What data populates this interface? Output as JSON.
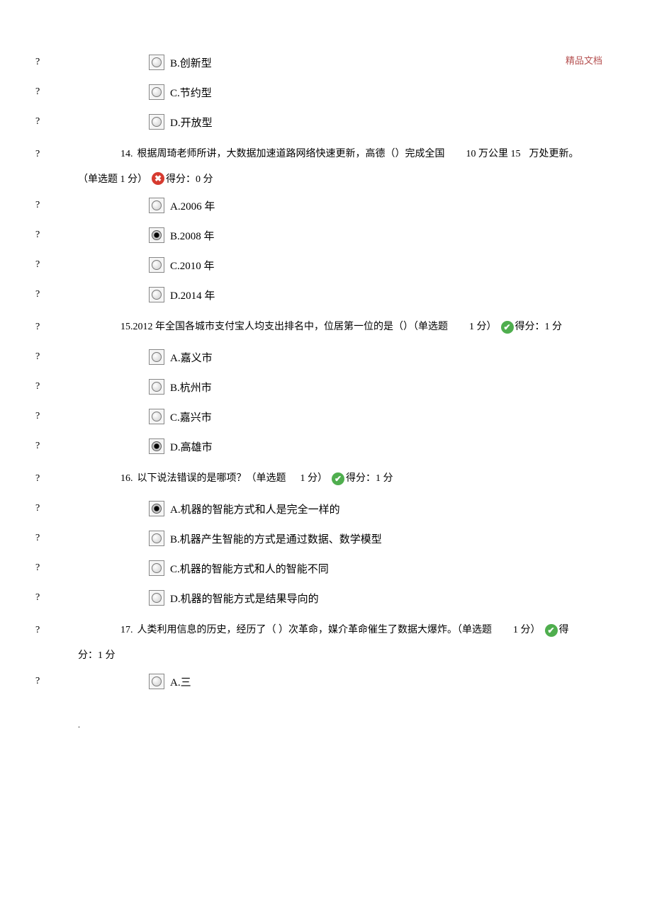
{
  "watermark": "精品文档",
  "bullet_char": "?",
  "footer_dot": ".",
  "options_q13": [
    {
      "label": "B.创新型",
      "selected": false
    },
    {
      "label": "C.节约型",
      "selected": false
    },
    {
      "label": "D.开放型",
      "selected": false
    }
  ],
  "q14": {
    "num": "14.",
    "stem_part1": "根据周琦老师所讲，大数据加速道路网络快速更新，高德（）完成全国",
    "stem_part2": "10 万公里 15",
    "stem_part3": "万处更新。",
    "meta": "（单选题 1 分）",
    "score_label": "得分：0 分",
    "result": "wrong",
    "options": [
      {
        "label": "A.2006  年",
        "selected": false
      },
      {
        "label": "B.2008  年",
        "selected": true
      },
      {
        "label": "C.2010  年",
        "selected": false
      },
      {
        "label": "D.2014  年",
        "selected": false
      }
    ]
  },
  "q15": {
    "num": "15.",
    "stem": "2012  年全国各城市支付宝人均支出排名中，位居第一位的是（）（单选题",
    "meta_right": "1 分）",
    "score_label": "得分：1 分",
    "result": "right",
    "options": [
      {
        "label": "A.嘉义市",
        "selected": false
      },
      {
        "label": "B.杭州市",
        "selected": false
      },
      {
        "label": "C.嘉兴市",
        "selected": false
      },
      {
        "label": "D.高雄市",
        "selected": true
      }
    ]
  },
  "q16": {
    "num": "16.",
    "stem": "以下说法错误的是哪项？（单选题",
    "meta_right": "1 分）",
    "score_label": "得分：1 分",
    "result": "right",
    "options": [
      {
        "label": "A.机器的智能方式和人是完全一样的",
        "selected": true
      },
      {
        "label": "B.机器产生智能的方式是通过数据、数学模型",
        "selected": false
      },
      {
        "label": "C.机器的智能方式和人的智能不同",
        "selected": false
      },
      {
        "label": "D.机器的智能方式是结果导向的",
        "selected": false
      }
    ]
  },
  "q17": {
    "num": "17.",
    "stem": "人类利用信息的历史，经历了（      ）次革命，媒介革命催生了数据大爆炸。（单选题",
    "meta_right": "1 分）",
    "score_lead": "得",
    "score_line2": "分：1 分",
    "result": "right",
    "options": [
      {
        "label": "A.三",
        "selected": false
      }
    ]
  }
}
